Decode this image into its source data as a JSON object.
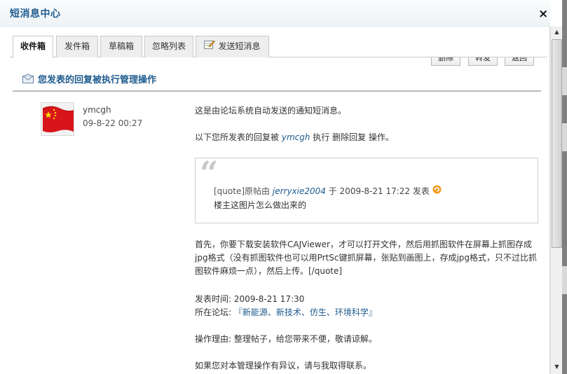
{
  "dialog": {
    "title": "短消息中心",
    "close_label": "×"
  },
  "tabs": [
    {
      "label": "收件箱",
      "active": true
    },
    {
      "label": "发件箱",
      "active": false
    },
    {
      "label": "草稿箱",
      "active": false
    },
    {
      "label": "忽略列表",
      "active": false
    },
    {
      "label": "发送短消息",
      "active": false,
      "icon": "compose-icon"
    }
  ],
  "actions": {
    "delete_label": "删除",
    "forward_label": "转发",
    "back_label": "返回"
  },
  "message": {
    "title": "您发表的回复被执行管理操作",
    "sender": {
      "name": "ymcgh",
      "time": "09-8-22 00:27"
    },
    "line1": "这是由论坛系统自动发送的通知短消息。",
    "line2_prefix": "以下您所发表的回复被",
    "line2_user": "ymcgh",
    "line2_suffix": "执行 删除回复 操作。",
    "quote": {
      "prefix": "[quote]原帖由",
      "author": "jerryxie2004",
      "date_text": "于 2009-8-21 17:22 发表",
      "body": "楼主这图片怎么做出来的"
    },
    "paragraph": "首先，你要下载安装软件CAJViewer，才可以打开文件，然后用抓图软件在屏幕上抓图存成jpg格式（没有抓图软件也可以用PrtSc键抓屏幕，张贴到画图上，存成jpg格式，只不过比抓图软件麻烦一点），然后上传。[/quote]",
    "posted_label": "发表时间:",
    "posted_time": "2009-8-21 17:30",
    "forum_label": "所在论坛:",
    "forum_name": "『新能源、新技术、仿生、环境科学』",
    "reason_label": "操作理由:",
    "reason_text": "整理帖子，给您带来不便，敬请谅解。",
    "contact_text": "如果您对本管理操作有异议，请与我取得联系。"
  },
  "colors": {
    "accent": "#1e5b8e",
    "link": "#1e5b8e",
    "border": "#c9c9c9"
  }
}
